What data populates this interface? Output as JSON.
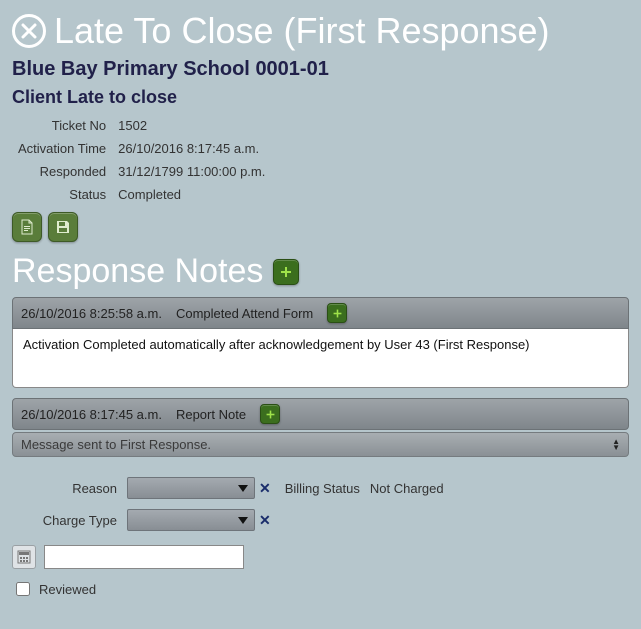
{
  "header": {
    "title": "Late To Close (First Response)",
    "client_name": "Blue Bay Primary School",
    "client_code": "0001-01",
    "client_desc": "Client Late to close"
  },
  "details": {
    "ticket_label": "Ticket No",
    "ticket_value": "1502",
    "activation_label": "Activation Time",
    "activation_value": "26/10/2016 8:17:45 a.m.",
    "responded_label": "Responded",
    "responded_value": "31/12/1799 11:00:00 p.m.",
    "status_label": "Status",
    "status_value": "Completed"
  },
  "notes_section_title": "Response Notes",
  "notes": [
    {
      "timestamp": "26/10/2016 8:25:58 a.m.",
      "type": "Completed Attend Form",
      "body": "Activation Completed automatically after acknowledgement by User 43 (First Response)"
    },
    {
      "timestamp": "26/10/2016 8:17:45 a.m.",
      "type": "Report Note",
      "collapsed_message": "Message sent to First Response."
    }
  ],
  "form": {
    "reason_label": "Reason",
    "charge_type_label": "Charge Type",
    "billing_status_label": "Billing Status",
    "billing_status_value": "Not Charged",
    "calc_value": "",
    "reviewed_label": "Reviewed"
  }
}
